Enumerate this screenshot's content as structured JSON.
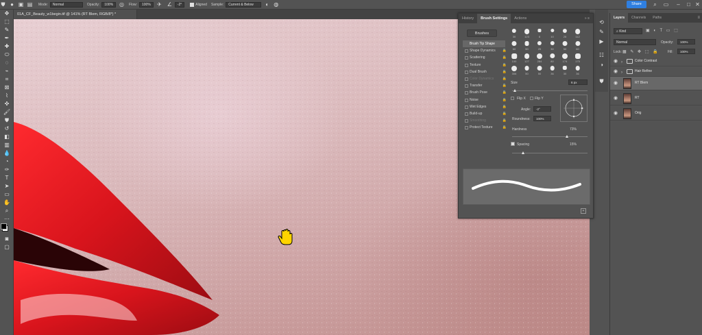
{
  "options_bar": {
    "mode_label": "Mode:",
    "mode_value": "Normal",
    "opacity_label": "Opacity:",
    "opacity_value": "100%",
    "flow_label": "Flow:",
    "flow_value": "100%",
    "angle_value": "-2°",
    "aligned_label": "Aligned",
    "sample_label": "Sample:",
    "sample_value": "Current & Below",
    "share_label": "Share"
  },
  "document": {
    "tab_title": "01A_CF_Beauty_w1begin.tif @ 141% (RT Blem, RGB/8*) *"
  },
  "brush_panel": {
    "tabs": [
      "History",
      "Brush Settings",
      "Actions"
    ],
    "active_tab": "Brush Settings",
    "brushes_button": "Brushes",
    "options": [
      {
        "label": "Brush Tip Shape",
        "selected": true,
        "checkbox": false,
        "lock": false
      },
      {
        "label": "Shape Dynamics",
        "checkbox": true,
        "lock": true
      },
      {
        "label": "Scattering",
        "checkbox": true,
        "lock": true
      },
      {
        "label": "Texture",
        "checkbox": true,
        "lock": true
      },
      {
        "label": "Dual Brush",
        "checkbox": true,
        "lock": true
      },
      {
        "label": "Color Dynamics",
        "checkbox": true,
        "lock": true,
        "dim": true
      },
      {
        "label": "Transfer",
        "checkbox": true,
        "lock": true
      },
      {
        "label": "Brush Pose",
        "checkbox": true,
        "lock": true
      },
      {
        "label": "Noise",
        "checkbox": true,
        "lock": true
      },
      {
        "label": "Wet Edges",
        "checkbox": true,
        "lock": true
      },
      {
        "label": "Build-up",
        "checkbox": true,
        "lock": true
      },
      {
        "label": "Smoothing",
        "checkbox": true,
        "lock": true,
        "dim": true
      },
      {
        "label": "Protect Texture",
        "checkbox": true,
        "lock": true
      }
    ],
    "tip_sizes": [
      "30",
      "123",
      "8",
      "10",
      "25",
      "112",
      "60",
      "50",
      "25",
      "30",
      "50",
      "60",
      "100",
      "127",
      "284",
      "80",
      "174",
      "175",
      "306",
      "50",
      "50",
      "36",
      "30",
      "36"
    ],
    "size_label": "Size",
    "size_value": "6 px",
    "flip_x_label": "Flip X",
    "flip_y_label": "Flip Y",
    "angle_label": "Angle:",
    "angle_value": "-2°",
    "roundness_label": "Roundness:",
    "roundness_value": "100%",
    "hardness_label": "Hardness",
    "hardness_value": "73%",
    "hardness_level": 0.73,
    "spacing_label": "Spacing",
    "spacing_value": "15%",
    "spacing_level": 0.15
  },
  "layers_panel": {
    "tabs": [
      "Layers",
      "Channels",
      "Paths"
    ],
    "active_tab": "Layers",
    "filter_kind": "Kind",
    "blend_mode": "Normal",
    "opacity_label": "Opacity:",
    "opacity_value": "100%",
    "lock_label": "Lock:",
    "fill_label": "Fill:",
    "fill_value": "100%",
    "layers": [
      {
        "name": "Color Contrast",
        "type": "group",
        "selected": false
      },
      {
        "name": "Hair Refine",
        "type": "group",
        "selected": false
      },
      {
        "name": "RT Blem",
        "type": "pixel",
        "selected": true
      },
      {
        "name": "RT",
        "type": "pixel",
        "selected": false
      },
      {
        "name": "Orig",
        "type": "pixel",
        "selected": false
      }
    ]
  },
  "colors": {
    "ui_bg": "#535353",
    "panel_dark": "#3f3f3f",
    "accent_blue": "#2f7fe0",
    "lip_red": "#d8141c",
    "skin": "#d7b4b6"
  },
  "icons": {
    "toolbar": [
      "move-icon",
      "artboard-icon",
      "brush-icon",
      "pen-icon",
      "healing-icon",
      "marquee-icon",
      "lasso-icon",
      "quick-select-icon",
      "crop-icon",
      "frame-icon",
      "eyedropper-icon",
      "spot-heal-icon",
      "brush-tool-icon",
      "clone-stamp-icon",
      "history-brush-icon",
      "eraser-icon",
      "gradient-icon",
      "blur-icon",
      "dodge-icon",
      "pen-tool-icon",
      "type-icon",
      "path-select-icon",
      "rectangle-icon",
      "hand-icon",
      "zoom-icon",
      "more-icon",
      "color-swatch-icon",
      "quick-mask-icon",
      "screen-mode-icon"
    ],
    "cursor": "hand-cursor-icon"
  }
}
